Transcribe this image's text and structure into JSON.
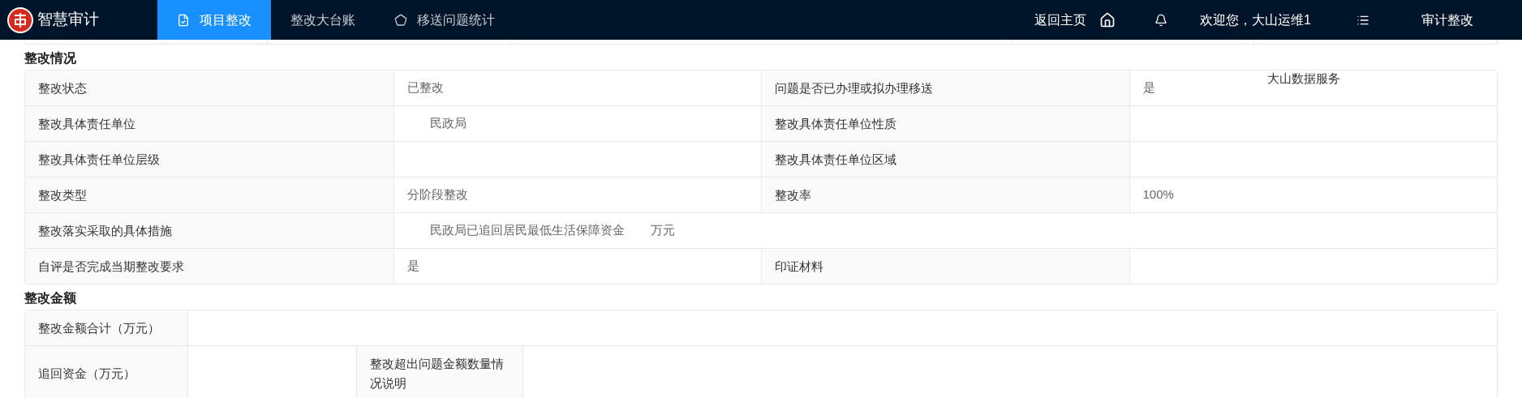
{
  "header": {
    "brand": "智慧审计",
    "tabs": [
      {
        "label": "项目整改",
        "kind": "document",
        "selected": true
      },
      {
        "label": "整改大台账",
        "kind": "plain",
        "selected": false
      },
      {
        "label": "移送问题统计",
        "kind": "pentagon",
        "selected": false
      }
    ],
    "home_link": "返回主页",
    "greeting": "欢迎您，大山运维1",
    "module": "审计整改"
  },
  "overlay_text": "大山数据服务",
  "sections": [
    {
      "title": "整改情况",
      "kind": "equal",
      "rows": [
        [
          {
            "kind": "label",
            "text": "整改状态"
          },
          {
            "kind": "value",
            "text": "已整改"
          },
          {
            "kind": "label",
            "text": "问题是否已办理或拟办理移送"
          },
          {
            "kind": "value",
            "text": "是"
          }
        ],
        [
          {
            "kind": "label",
            "text": "整改具体责任单位"
          },
          {
            "kind": "value",
            "parts": [
              "民政局"
            ],
            "indent": true
          },
          {
            "kind": "label",
            "text": "整改具体责任单位性质"
          },
          {
            "kind": "value"
          }
        ],
        [
          {
            "kind": "label",
            "text": "整改具体责任单位层级"
          },
          {
            "kind": "value"
          },
          {
            "kind": "label",
            "text": "整改具体责任单位区域"
          },
          {
            "kind": "value"
          }
        ],
        [
          {
            "kind": "label",
            "text": "整改类型"
          },
          {
            "kind": "value",
            "text": "分阶段整改"
          },
          {
            "kind": "label",
            "text": "整改率"
          },
          {
            "kind": "value",
            "text": "100%"
          }
        ],
        [
          {
            "kind": "label",
            "text": "整改落实采取的具体措施"
          },
          {
            "kind": "value",
            "parts": [
              "民政局已追回居民最低生活保障资金",
              "万元"
            ],
            "indent": true
          }
        ],
        [
          {
            "kind": "label",
            "text": "自评是否完成当期整改要求"
          },
          {
            "kind": "value",
            "text": "是"
          },
          {
            "kind": "label",
            "text": "印证材料"
          },
          {
            "kind": "value"
          }
        ]
      ]
    },
    {
      "title": "整改金额",
      "kind": "wide_last",
      "rows": [
        [
          {
            "kind": "label",
            "text": "整改金额合计（万元）"
          },
          {
            "kind": "value"
          }
        ],
        [
          {
            "kind": "label",
            "text": "追回资金（万元）"
          },
          {
            "kind": "value"
          },
          {
            "kind": "label",
            "text": "整改超出问题金额数量情况说明"
          },
          {
            "kind": "value"
          }
        ]
      ]
    }
  ]
}
